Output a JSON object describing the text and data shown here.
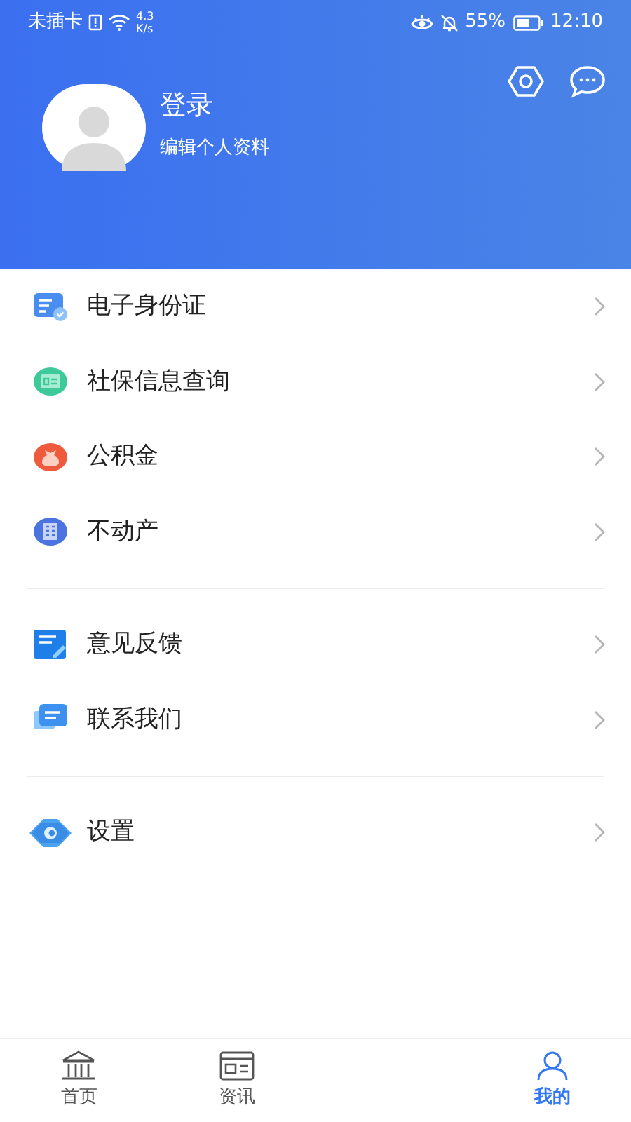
{
  "status_bar": {
    "carrier": "未插卡",
    "speed_value": "4.3",
    "speed_unit": "K/s",
    "battery": "55%",
    "time": "12:10"
  },
  "profile": {
    "name": "登录",
    "subtitle": "编辑个人资料"
  },
  "menu_groups": [
    [
      {
        "label": "电子身份证"
      },
      {
        "label": "社保信息查询"
      },
      {
        "label": "公积金"
      },
      {
        "label": "不动产"
      }
    ],
    [
      {
        "label": "意见反馈"
      },
      {
        "label": "联系我们"
      }
    ],
    [
      {
        "label": "设置"
      }
    ]
  ],
  "tabs": [
    {
      "label": "首页",
      "selected": false
    },
    {
      "label": "资讯",
      "selected": false
    },
    {
      "label": "我的",
      "selected": true
    }
  ]
}
